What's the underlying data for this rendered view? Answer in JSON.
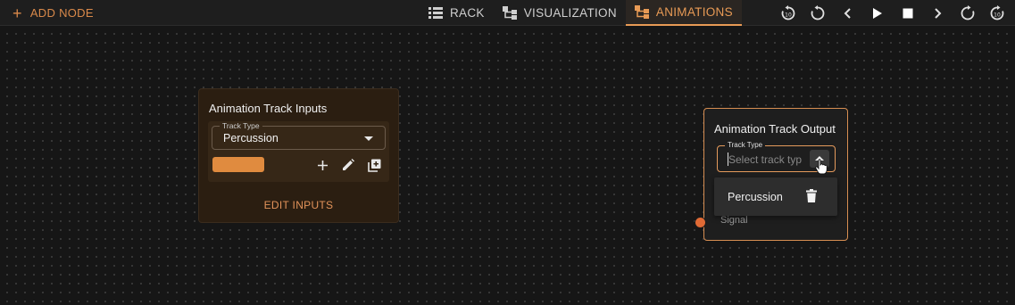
{
  "toolbar": {
    "add_node_label": "ADD NODE",
    "tabs": [
      {
        "label": "RACK",
        "icon": "list-icon",
        "active": false
      },
      {
        "label": "VISUALIZATION",
        "icon": "hierarchy-icon",
        "active": false
      },
      {
        "label": "ANIMATIONS",
        "icon": "hierarchy-icon",
        "active": true
      }
    ],
    "transport": [
      "rewind-10-icon",
      "restart-icon",
      "previous-icon",
      "play-icon",
      "stop-icon",
      "next-icon",
      "redo-icon",
      "forward-10-icon"
    ],
    "accent_color": "#e89a55"
  },
  "input_node": {
    "title": "Animation Track Inputs",
    "field_label": "Track Type",
    "field_value": "Percussion",
    "swatch_color": "#e08b3f",
    "edit_label": "EDIT INPUTS"
  },
  "output_node": {
    "title": "Animation Track Output",
    "field_label": "Track Type",
    "placeholder": "Select track typ",
    "options": [
      "Percussion"
    ],
    "signal_label": "Signal"
  }
}
